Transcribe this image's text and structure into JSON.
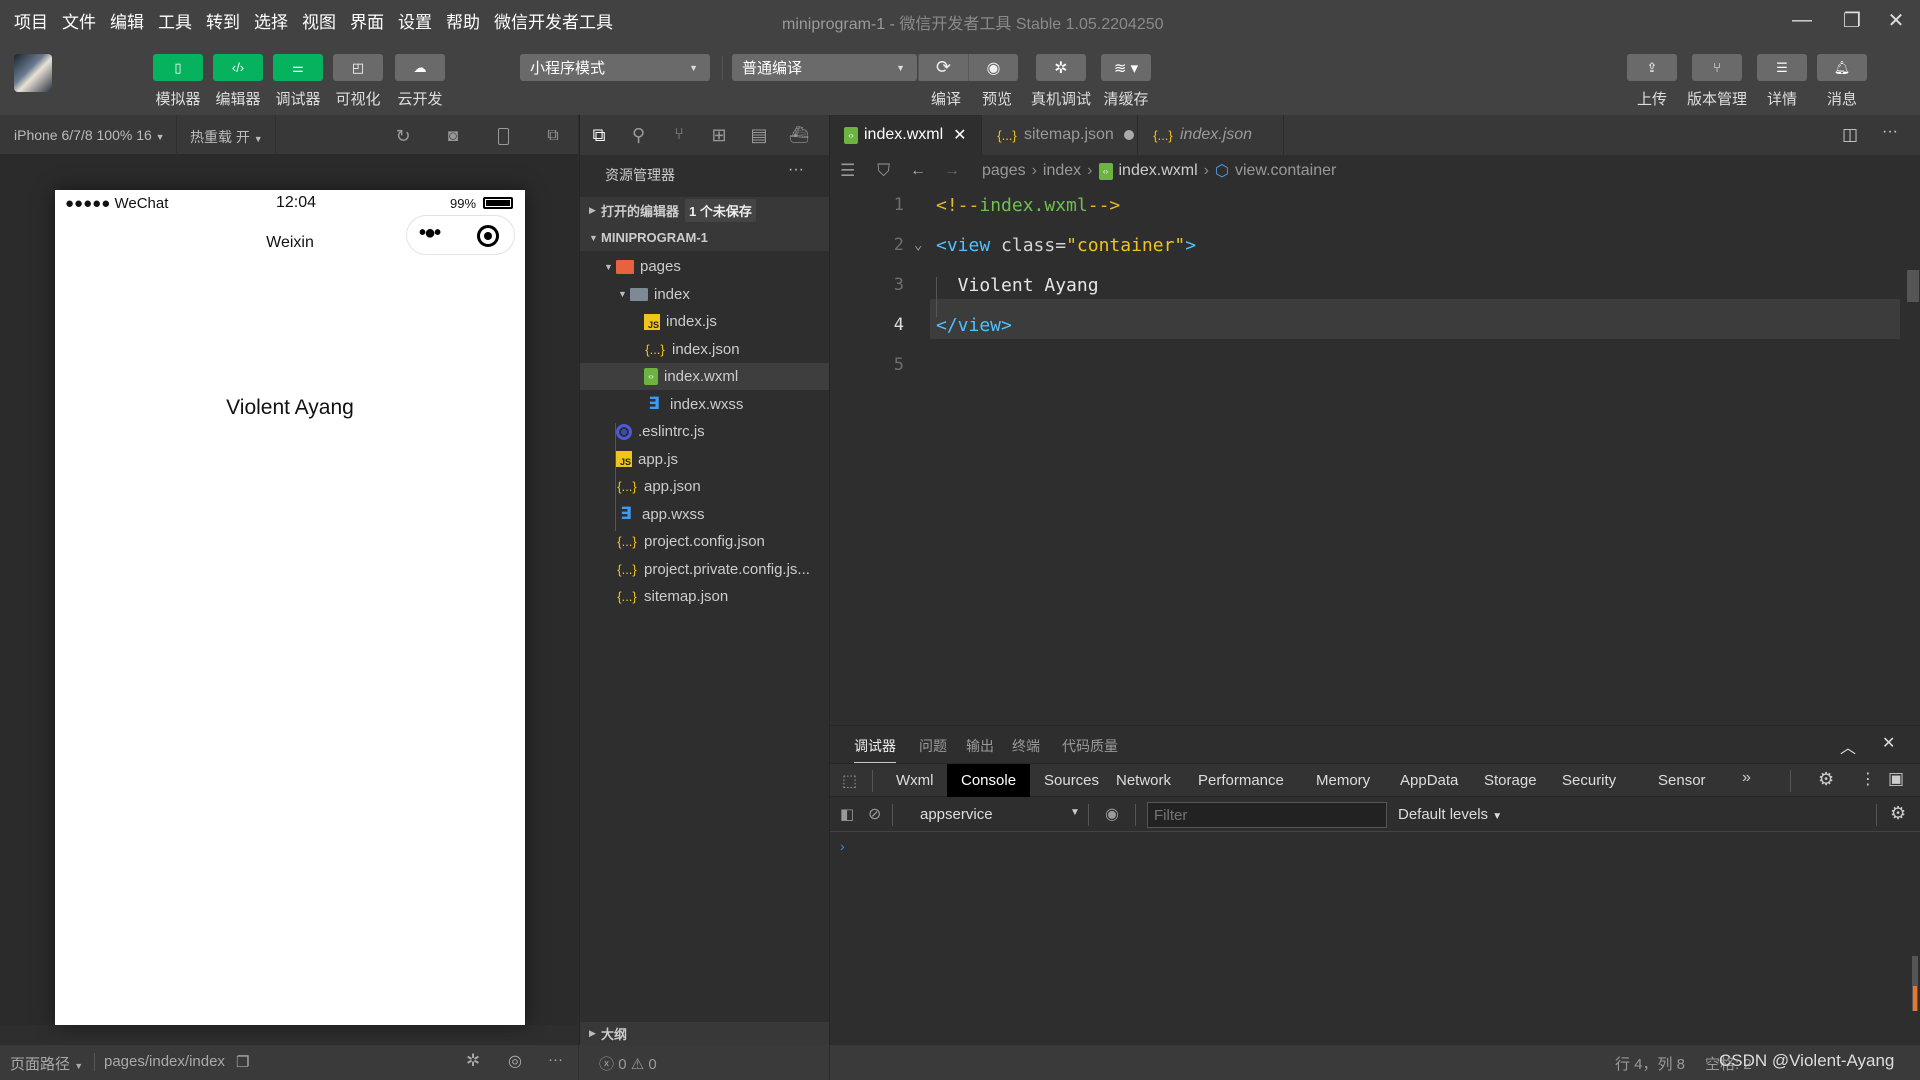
{
  "menu": [
    "项目",
    "文件",
    "编辑",
    "工具",
    "转到",
    "选择",
    "视图",
    "界面",
    "设置",
    "帮助",
    "微信开发者工具"
  ],
  "window": {
    "project": "miniprogram-1",
    "separator": "-",
    "app": "微信开发者工具 Stable 1.05.2204250"
  },
  "toolbar": {
    "left_buttons": [
      {
        "label": "模拟器",
        "icon": "phone-icon",
        "active": true
      },
      {
        "label": "编辑器",
        "icon": "code-icon",
        "active": true
      },
      {
        "label": "调试器",
        "icon": "sliders-icon",
        "active": true
      },
      {
        "label": "可视化",
        "icon": "layout-icon",
        "active": false
      },
      {
        "label": "云开发",
        "icon": "cloud-icon",
        "active": false
      }
    ],
    "mode_select": "小程序模式",
    "compile_select": "普通编译",
    "mid_labels": [
      "编译",
      "预览",
      "真机调试",
      "清缓存"
    ],
    "right_buttons": [
      {
        "label": "上传",
        "icon": "upload-icon"
      },
      {
        "label": "版本管理",
        "icon": "branch-icon"
      },
      {
        "label": "详情",
        "icon": "menu-icon"
      },
      {
        "label": "消息",
        "icon": "bell-icon"
      }
    ]
  },
  "simulator": {
    "device": "iPhone 6/7/8 100% 16",
    "hot_reload": "热重载 开",
    "status": {
      "carrier": "●●●●● WeChat",
      "time": "12:04",
      "battery": "99%"
    },
    "nav_title": "Weixin",
    "capsule_dots": "•●•",
    "content": "Violent Ayang",
    "footer": {
      "path_label": "页面路径",
      "path": "pages/index/index"
    }
  },
  "explorer": {
    "title": "资源管理器",
    "open_editors": "打开的编辑器",
    "unsaved_badge": "1 个未保存",
    "project": "MINIPROGRAM-1",
    "tree": [
      {
        "name": "pages",
        "type": "pages",
        "depth": 0,
        "expanded": true
      },
      {
        "name": "index",
        "type": "folder",
        "depth": 1,
        "expanded": true
      },
      {
        "name": "index.js",
        "type": "js",
        "depth": 2
      },
      {
        "name": "index.json",
        "type": "json",
        "depth": 2
      },
      {
        "name": "index.wxml",
        "type": "wxml",
        "depth": 2,
        "selected": true
      },
      {
        "name": "index.wxss",
        "type": "wxss",
        "depth": 2
      },
      {
        "name": ".eslintrc.js",
        "type": "eslint",
        "depth": 0
      },
      {
        "name": "app.js",
        "type": "js",
        "depth": 0
      },
      {
        "name": "app.json",
        "type": "json",
        "depth": 0
      },
      {
        "name": "app.wxss",
        "type": "wxss",
        "depth": 0
      },
      {
        "name": "project.config.json",
        "type": "json",
        "depth": 0
      },
      {
        "name": "project.private.config.js...",
        "type": "json",
        "depth": 0
      },
      {
        "name": "sitemap.json",
        "type": "json",
        "depth": 0
      }
    ],
    "outline": "大纲",
    "errors": "0",
    "warnings": "0"
  },
  "editor": {
    "tabs": [
      {
        "name": "index.wxml",
        "type": "wxml",
        "active": true,
        "close": "✕"
      },
      {
        "name": "sitemap.json",
        "type": "json",
        "dirty": true
      },
      {
        "name": "index.json",
        "type": "json",
        "preview": true
      }
    ],
    "breadcrumb": [
      "pages",
      "index",
      "index.wxml",
      "view.container"
    ],
    "lines": [
      {
        "n": "1",
        "tokens": [
          [
            "c-punc",
            "<!--"
          ],
          [
            "c-cmt",
            "index.wxml"
          ],
          [
            "c-punc",
            "-->"
          ]
        ]
      },
      {
        "n": "2",
        "tokens": [
          [
            "c-tag",
            "<view "
          ],
          [
            "c-attr",
            "class="
          ],
          [
            "c-str",
            "\"container\""
          ],
          [
            "c-tag",
            ">"
          ]
        ]
      },
      {
        "n": "3",
        "tokens": [
          [
            "c-txt",
            "  Violent Ayang"
          ]
        ]
      },
      {
        "n": "4",
        "tokens": [
          [
            "c-tag",
            "</view>"
          ]
        ]
      },
      {
        "n": "5",
        "tokens": []
      }
    ],
    "current_line": 4
  },
  "debugger": {
    "panel_tabs": [
      "调试器",
      "问题",
      "输出",
      "终端",
      "代码质量"
    ],
    "devtools_tabs": [
      "Wxml",
      "Console",
      "Sources",
      "Network",
      "Performance",
      "Memory",
      "AppData",
      "Storage",
      "Security",
      "Sensor"
    ],
    "active_devtools_tab": "Console",
    "context": "appservice",
    "filter_placeholder": "Filter",
    "levels": "Default levels",
    "prompt": "›"
  },
  "statusbar": {
    "position": "行 4，列 8",
    "indent": "空格: 2",
    "watermark": "CSDN @Violent-Ayang"
  }
}
